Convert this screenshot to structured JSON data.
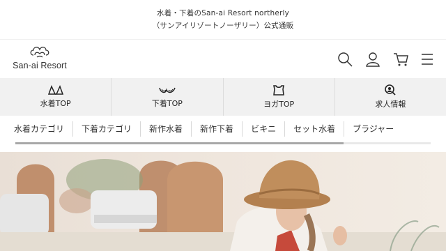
{
  "announcement": {
    "line1": "水着・下着のSan-ai Resort northerly",
    "line2": "（サンアイリゾートノーザリー）公式通販"
  },
  "header": {
    "logo_text": "San-ai Resort",
    "icons": [
      "search-icon",
      "account-icon",
      "cart-icon",
      "menu-icon"
    ]
  },
  "categories": [
    {
      "label": "水着TOP",
      "icon": "swimwear-icon"
    },
    {
      "label": "下着TOP",
      "icon": "lingerie-icon"
    },
    {
      "label": "ヨガTOP",
      "icon": "yoga-top-icon"
    },
    {
      "label": "求人情報",
      "icon": "recruit-search-icon"
    }
  ],
  "subnav": {
    "items": [
      "水着カテゴリ",
      "下着カテゴリ",
      "新作水着",
      "新作下着",
      "ビキニ",
      "セット水着",
      "ブラジャー"
    ],
    "scroll_position": 0.79
  },
  "colors": {
    "category_bar": "#f1f1f1",
    "scroll_thumb": "#a8a8a8",
    "text": "#333333"
  }
}
